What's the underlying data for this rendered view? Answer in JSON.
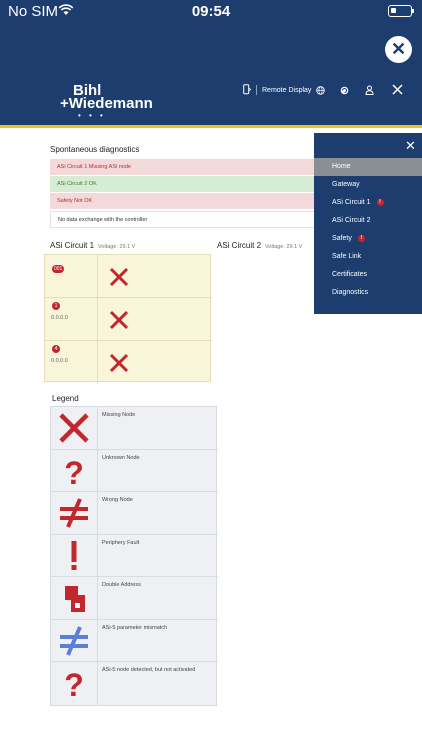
{
  "statusbar": {
    "carrier": "No SIM",
    "time": "09:54"
  },
  "header": {
    "brand_line1": "Bihl",
    "brand_line2": "+Wiedemann",
    "brand_dots": "• • •",
    "remote_display": "Remote Display"
  },
  "spontaneous": {
    "title": "Spontaneous diagnostics",
    "rows": [
      {
        "text": "ASi Circuit 1   Missing ASi node",
        "status": "error"
      },
      {
        "text": "ASi Circuit 2   OK",
        "status": "ok"
      },
      {
        "text": "Safety   Not OK",
        "status": "error"
      },
      {
        "text": "No data exchange with the controller",
        "status": "plain"
      }
    ]
  },
  "circuits": [
    {
      "name": "ASi Circuit 1",
      "voltage": "Voltage: 29.1 V"
    },
    {
      "name": "ASi Circuit 2",
      "voltage": "Voltage: 29.1 V"
    }
  ],
  "nodes": [
    {
      "badge": "001",
      "address": "",
      "symbol": "missing"
    },
    {
      "badge": "1",
      "address": "0.0.0.0",
      "symbol": "missing"
    },
    {
      "badge": "4",
      "address": "0.0.0.0",
      "symbol": "missing"
    }
  ],
  "legend": {
    "title": "Legend",
    "items": [
      {
        "label": "Missing Node",
        "icon": "red-x-icon"
      },
      {
        "label": "Unknown Node",
        "icon": "red-question-icon"
      },
      {
        "label": "Wrong Node",
        "icon": "red-not-equal-icon"
      },
      {
        "label": "Periphery Fault",
        "icon": "red-exclamation-icon"
      },
      {
        "label": "Double Address",
        "icon": "double-address-icon"
      },
      {
        "label": "ASi-5 parameter mismatch",
        "icon": "blue-not-equal-icon"
      },
      {
        "label": "ASi-5 node detected, but not activated",
        "icon": "red-question-icon"
      }
    ]
  },
  "menu": {
    "items": [
      {
        "label": "Home",
        "active": true,
        "warning": false
      },
      {
        "label": "Gateway",
        "active": false,
        "warning": false
      },
      {
        "label": "ASi Circuit 1",
        "active": false,
        "warning": true
      },
      {
        "label": "ASi Circuit 2",
        "active": false,
        "warning": false
      },
      {
        "label": "Safety",
        "active": false,
        "warning": true
      },
      {
        "label": "Safe Link",
        "active": false,
        "warning": false
      },
      {
        "label": "Certificates",
        "active": false,
        "warning": false
      },
      {
        "label": "Diagnostics",
        "active": false,
        "warning": false
      }
    ],
    "warning_glyph": "!"
  },
  "colors": {
    "navy": "#1c3d6e",
    "accent": "#f0c419",
    "error": "#c1272d",
    "asi5": "#5b7fd6"
  }
}
